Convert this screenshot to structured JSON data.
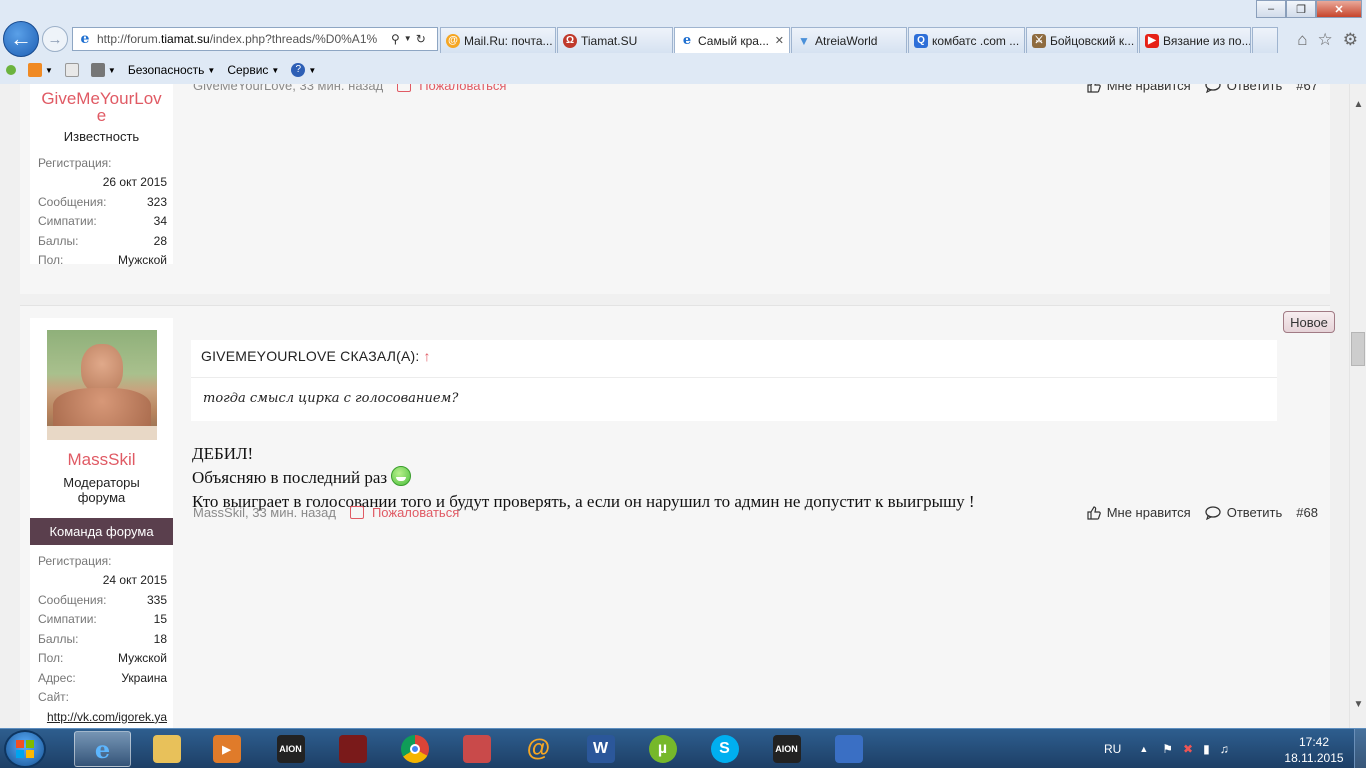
{
  "browser": {
    "url_prefix": "http://forum.",
    "url_domain": "tiamat.su",
    "url_rest": "/index.php?threads/%D0%A1%",
    "tabs": [
      {
        "label": "Mail.Ru: почта...",
        "icon_color": "#f5a623"
      },
      {
        "label": "Tiamat.SU",
        "icon_color": "#c0392b"
      },
      {
        "label": "Самый кра...",
        "icon_color": "#1e6fd0"
      },
      {
        "label": "AtreiaWorld",
        "icon_color": "#4a90d9"
      },
      {
        "label": "комбатс .com ...",
        "icon_color": "#2e6fd8"
      },
      {
        "label": "Бойцовский к...",
        "icon_color": "#8e6b3f"
      },
      {
        "label": "Вязание из по...",
        "icon_color": "#e62117"
      }
    ],
    "commands": {
      "safety": "Безопасность",
      "service": "Сервис"
    }
  },
  "post67": {
    "username_partial": "GiveMeYourLov",
    "username_tail": "e",
    "user_title": "Известность",
    "meta_author": "GiveMeYourLove, 33 мин. назад",
    "report": "Пожаловаться",
    "like": "Мне нравится",
    "reply": "Ответить",
    "number": "#67",
    "stats": {
      "reg_label": "Регистрация:",
      "reg_value": "26 окт 2015",
      "msgs_label": "Сообщения:",
      "msgs_value": "323",
      "likes_label": "Симпатии:",
      "likes_value": "34",
      "points_label": "Баллы:",
      "points_value": "28",
      "gender_label": "Пол:",
      "gender_value": "Мужской"
    }
  },
  "post68": {
    "username": "MassSkil",
    "user_title_1": "Модераторы",
    "user_title_2": "форума",
    "banner": "Команда форума",
    "quote_header": "GIVEMEYOURLOVE СКАЗАЛ(А):",
    "quote_arrow": "↑",
    "quote_text": "тогда смысл цирка с голосованием?",
    "line1": "ДЕБИЛ!",
    "line2": "Объясняю в последний раз",
    "line3": "Кто выиграет в голосовании того и будут проверять, а если он нарушил то админ не допустит к выигрышу !",
    "meta_author": "MassSkil, 33 мин. назад",
    "report": "Пожаловаться",
    "like": "Мне нравится",
    "reply": "Ответить",
    "number": "#68",
    "new_badge": "Новое",
    "stats": {
      "reg_label": "Регистрация:",
      "reg_value": "24 окт 2015",
      "msgs_label": "Сообщения:",
      "msgs_value": "335",
      "likes_label": "Симпатии:",
      "likes_value": "15",
      "points_label": "Баллы:",
      "points_value": "18",
      "gender_label": "Пол:",
      "gender_value": "Мужской",
      "addr_label": "Адрес:",
      "addr_value": "Украина",
      "site_label": "Сайт:",
      "site_value": "http://vk.com/igorek.ya"
    }
  },
  "taskbar": {
    "lang": "RU",
    "time": "17:42",
    "date": "18.11.2015"
  }
}
